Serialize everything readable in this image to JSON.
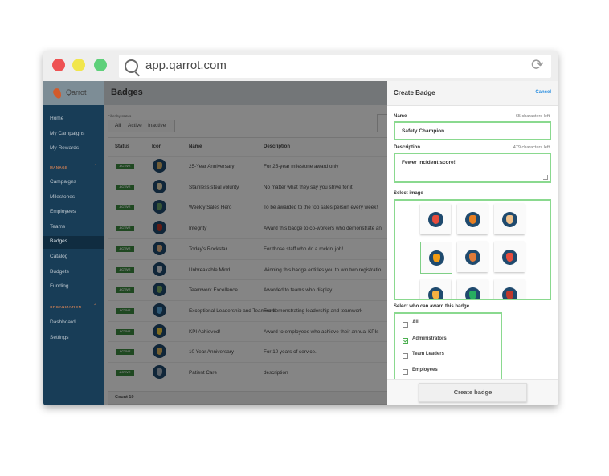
{
  "browser": {
    "url": "app.qarrot.com"
  },
  "brand": {
    "name": "Qarrot"
  },
  "sidebar": {
    "items": [
      "Home",
      "My Campaigns",
      "My Rewards"
    ],
    "manage_label": "MANAGE",
    "manage_items": [
      "Campaigns",
      "Milestones",
      "Employees",
      "Teams",
      "Badges",
      "Catalog",
      "Budgets",
      "Funding"
    ],
    "org_label": "ORGANIZATION",
    "org_items": [
      "Dashboard",
      "Settings"
    ],
    "active": "Badges"
  },
  "main": {
    "title": "Badges",
    "filter_label": "Filter by status",
    "filters": [
      "All",
      "Active",
      "Inactive"
    ],
    "columns": [
      "Status",
      "Icon",
      "Name",
      "Description"
    ],
    "rows": [
      {
        "status": "ACTIVE",
        "name": "25-Year Anniversary",
        "description": "For 25-year milestone award only",
        "icon_color": "#d9b36a"
      },
      {
        "status": "ACTIVE",
        "name": "Stainless steal volunty",
        "description": "No matter what they say you strive for it",
        "icon_color": "#e8d9b5"
      },
      {
        "status": "ACTIVE",
        "name": "Weekly Sales Hero",
        "description": "To be awarded to the top sales person every week!",
        "icon_color": "#6aa36a"
      },
      {
        "status": "ACTIVE",
        "name": "Integrity",
        "description": "Award this badge to co-workers who demonstrate an",
        "icon_color": "#c0392b"
      },
      {
        "status": "ACTIVE",
        "name": "Today's Rockstar",
        "description": "For those staff who do a rockin' job!",
        "icon_color": "#e8b98a"
      },
      {
        "status": "ACTIVE",
        "name": "Unbreakable Mind",
        "description": "Winning this badge entitles you to win two registratio",
        "icon_color": "#d8dde2"
      },
      {
        "status": "ACTIVE",
        "name": "Teamwork Excellence",
        "description": "Awarded to teams who display ...",
        "icon_color": "#7fb069"
      },
      {
        "status": "ACTIVE",
        "name": "Exceptional Leadership and Teamwork",
        "description": "For demonstrating leadership and teamwork",
        "icon_color": "#5dade2"
      },
      {
        "status": "ACTIVE",
        "name": "KPI Achieved!",
        "description": "Award to employees who achieve their annual KPIs",
        "icon_color": "#f4d03f"
      },
      {
        "status": "ACTIVE",
        "name": "10 Year Anniversary",
        "description": "For 10 years of service.",
        "icon_color": "#e0b860"
      },
      {
        "status": "ACTIVE",
        "name": "Patient Care",
        "description": "description",
        "icon_color": "#aab7c4"
      }
    ],
    "count_text": "Count 19"
  },
  "panel": {
    "title": "Create Badge",
    "cancel_label": "Cancel",
    "name_label": "Name",
    "name_chars_left": "65 characters left",
    "name_value": "Safety Champion",
    "description_label": "Description",
    "description_chars_left": "479 characters left",
    "description_value": "Fewer incident score!",
    "image_label": "Select image",
    "images": [
      {
        "icon": "theater-masks-icon",
        "color": "#e74c3c"
      },
      {
        "icon": "briefcase-icon",
        "color": "#e67e22"
      },
      {
        "icon": "peace-hand-icon",
        "color": "#f0c08a"
      },
      {
        "icon": "traffic-cone-icon",
        "color": "#f39c12"
      },
      {
        "icon": "umbrella-icon",
        "color": "#e07b39"
      },
      {
        "icon": "first-aid-kit-icon",
        "color": "#e74c3c"
      },
      {
        "icon": "shield-icon",
        "color": "#f5b041"
      },
      {
        "icon": "hardhat-icon",
        "color": "#27ae60"
      },
      {
        "icon": "necktie-icon",
        "color": "#c0392b"
      }
    ],
    "award_label": "Select who can award this badge",
    "award_options": [
      {
        "label": "All",
        "checked": false
      },
      {
        "label": "Administrators",
        "checked": true
      },
      {
        "label": "Team Leaders",
        "checked": false
      },
      {
        "label": "Employees",
        "checked": false
      }
    ],
    "create_label": "Create badge"
  },
  "colors": {
    "sidebar": "#183d57",
    "accent_green": "#8ad98f",
    "status_green": "#3c8a40",
    "link_blue": "#2b8fe0"
  }
}
